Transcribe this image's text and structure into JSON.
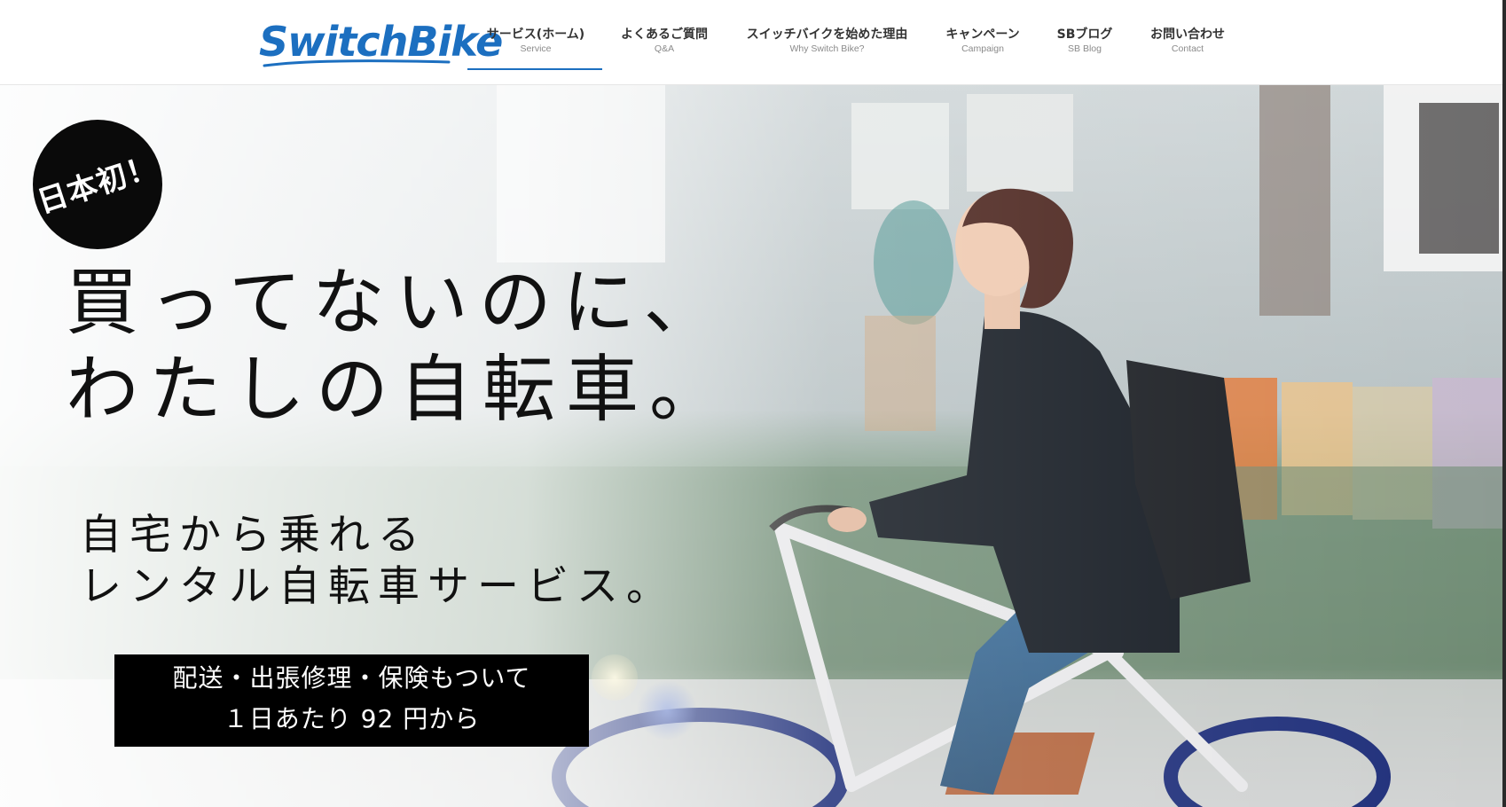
{
  "brand": {
    "logo_text": "SwitchBike",
    "logo_color": "#1c6fc0"
  },
  "nav": {
    "items": [
      {
        "label": "サービス(ホーム)",
        "sub": "Service",
        "active": true
      },
      {
        "label": "よくあるご質問",
        "sub": "Q&A",
        "active": false
      },
      {
        "label": "スイッチバイクを始めた理由",
        "sub": "Why Switch Bike?",
        "active": false
      },
      {
        "label": "キャンペーン",
        "sub": "Campaign",
        "active": false
      },
      {
        "label": "SBブログ",
        "sub": "SB Blog",
        "active": false
      },
      {
        "label": "お問い合わせ",
        "sub": "Contact",
        "active": false
      }
    ],
    "active_color": "#1c6fc0"
  },
  "hero": {
    "badge": "日本初！",
    "headline_line1": "買ってないのに、",
    "headline_line2": "わたしの自転車。",
    "subhead_line1": "自宅から乗れる",
    "subhead_line2": "レンタル自転車サービス。",
    "promo_line1": "配送・出張修理・保険もついて",
    "promo_line2": "１日あたり 92 円から"
  }
}
